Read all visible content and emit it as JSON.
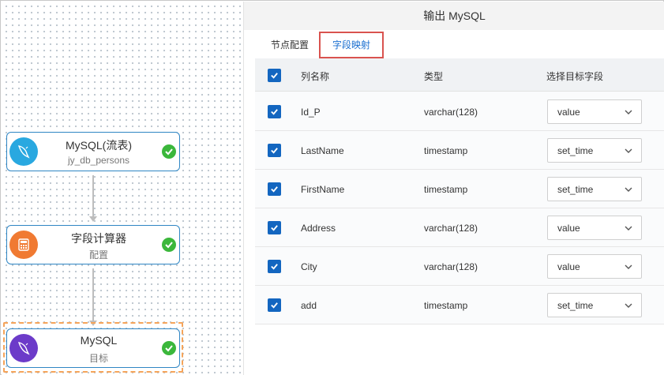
{
  "canvas": {
    "nodes": [
      {
        "title": "MySQL(流表)",
        "subtitle": "jy_db_persons",
        "icon": "mysql-dolphin-icon",
        "icon_color": "#29a8e0",
        "status": "check-icon"
      },
      {
        "title": "字段计算器",
        "subtitle": "配置",
        "icon": "calculator-icon",
        "icon_color": "#f07a32",
        "status": "check-icon"
      },
      {
        "title": "MySQL",
        "subtitle": "目标",
        "icon": "mysql-dolphin-icon",
        "icon_color": "#6c3bc9",
        "status": "check-icon",
        "selected": true
      }
    ]
  },
  "panel": {
    "title": "输出 MySQL",
    "tabs": [
      {
        "label": "节点配置",
        "active": false
      },
      {
        "label": "字段映射",
        "active": true
      }
    ],
    "table": {
      "headers": {
        "name": "列名称",
        "type": "类型",
        "target": "选择目标字段"
      },
      "rows": [
        {
          "name": "Id_P",
          "type": "varchar(128)",
          "target": "value",
          "checked": true
        },
        {
          "name": "LastName",
          "type": "timestamp",
          "target": "set_time",
          "checked": true
        },
        {
          "name": "FirstName",
          "type": "timestamp",
          "target": "set_time",
          "checked": true
        },
        {
          "name": "Address",
          "type": "varchar(128)",
          "target": "value",
          "checked": true
        },
        {
          "name": "City",
          "type": "varchar(128)",
          "target": "value",
          "checked": true
        },
        {
          "name": "add",
          "type": "timestamp",
          "target": "set_time",
          "checked": true
        }
      ]
    }
  },
  "colors": {
    "accent": "#1366c0",
    "success": "#3bb73b",
    "tab_highlight_border": "#d9534f",
    "selection_dash": "#f5a45a"
  }
}
